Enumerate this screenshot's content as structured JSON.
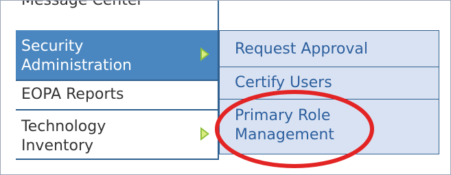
{
  "left_menu": {
    "items": [
      {
        "label": "Message Center"
      },
      {
        "label": "Security\nAdministration",
        "selected": true
      },
      {
        "label": "EOPA Reports"
      },
      {
        "label": "Technology\nInventory"
      }
    ],
    "selected_color": "#4a87c0",
    "divider_color": "#2e5f8f",
    "arrow_color": "#8fbf3a"
  },
  "submenu": {
    "items": [
      {
        "label": "Request Approval"
      },
      {
        "label": "Certify Users"
      },
      {
        "label": "Primary Role\nManagement"
      }
    ],
    "background": "#d9e2f2",
    "text_color": "#2c5f9e"
  },
  "annotation": {
    "type": "red-ellipse",
    "color": "#e32424",
    "target": "Primary Role Management"
  }
}
